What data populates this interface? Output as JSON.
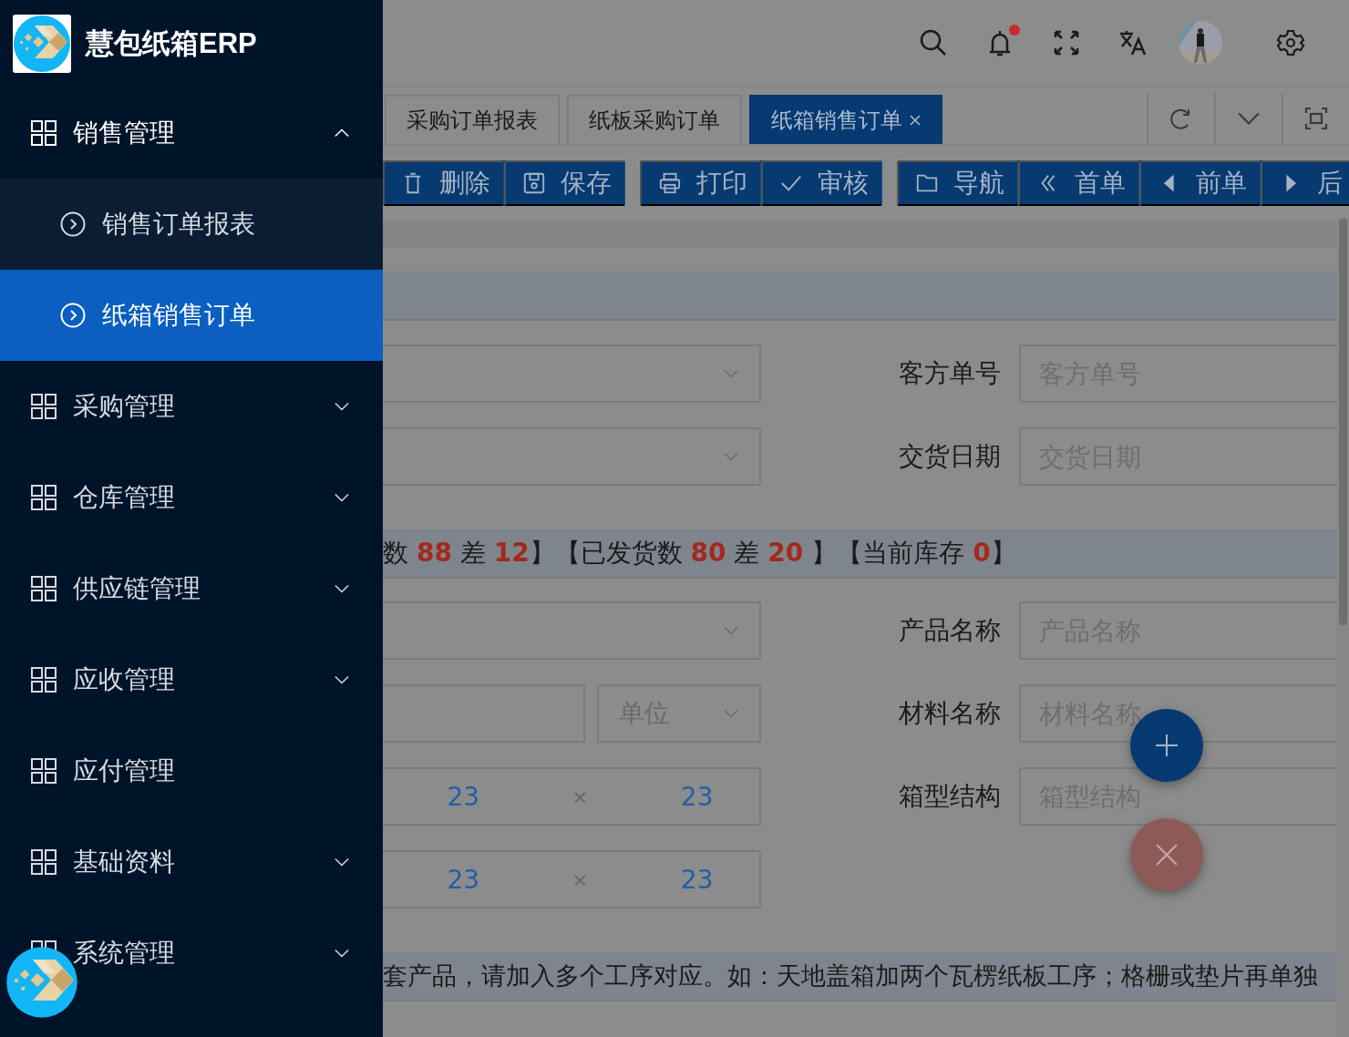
{
  "app": {
    "title": "慧包纸箱ERP"
  },
  "sidebar": {
    "items": [
      {
        "label": "销售管理",
        "kind": "submenu",
        "expanded": true,
        "children": [
          {
            "label": "销售订单报表",
            "selected": false
          },
          {
            "label": "纸箱销售订单",
            "selected": true
          }
        ]
      },
      {
        "label": "采购管理",
        "kind": "submenu",
        "expanded": false
      },
      {
        "label": "仓库管理",
        "kind": "submenu",
        "expanded": false
      },
      {
        "label": "供应链管理",
        "kind": "submenu",
        "expanded": false
      },
      {
        "label": "应收管理",
        "kind": "submenu",
        "expanded": false
      },
      {
        "label": "应付管理",
        "kind": "item"
      },
      {
        "label": "基础资料",
        "kind": "submenu",
        "expanded": false
      },
      {
        "label": "系统管理",
        "kind": "submenu",
        "expanded": false
      }
    ]
  },
  "header": {
    "has_unread": true
  },
  "tabs": [
    {
      "label": "采购订单报表",
      "selected": false
    },
    {
      "label": "纸板采购订单",
      "selected": false
    },
    {
      "label": "纸箱销售订单",
      "selected": true
    }
  ],
  "toolbar": {
    "groups": [
      [
        {
          "label": "删除",
          "kind": "delete"
        },
        {
          "label": "保存",
          "kind": "save"
        }
      ],
      [
        {
          "label": "打印",
          "kind": "print"
        },
        {
          "label": "审核",
          "kind": "approve"
        }
      ],
      [
        {
          "label": "导航",
          "kind": "navigate"
        },
        {
          "label": "首单",
          "kind": "first"
        },
        {
          "label": "前单",
          "kind": "previous"
        },
        {
          "label": "后",
          "kind": "next"
        }
      ]
    ]
  },
  "form_top": [
    {
      "left": {
        "kind": "select"
      },
      "right": {
        "label": "客方单号",
        "placeholder": "客方单号"
      }
    },
    {
      "left": {
        "kind": "select"
      },
      "right": {
        "label": "交货日期",
        "placeholder": "交货日期"
      }
    }
  ],
  "stock_info": {
    "text": "数 **88** 差 **12**】【已发货数 **80** 差 **20** 】【当前库存 **0**】"
  },
  "form_bottom": [
    {
      "left": {
        "kind": "select"
      },
      "right": {
        "label": "产品名称",
        "placeholder": "产品名称"
      }
    },
    {
      "left": {
        "kind": "input_unit",
        "unit_placeholder": "单位"
      },
      "right": {
        "label": "材料名称",
        "placeholder": "材料名称"
      }
    },
    {
      "left": {
        "kind": "size",
        "values": [
          "23",
          "23"
        ],
        "separator": "×"
      },
      "right": {
        "label": "箱型结构",
        "placeholder": "箱型结构"
      }
    },
    {
      "left": {
        "kind": "size",
        "values": [
          "23",
          "23"
        ],
        "separator": "×"
      }
    }
  ],
  "note": {
    "text": "套产品，请加入多个工序对应。如：天地盖箱加两个瓦楞纸板工序；格栅或垫片再单独"
  }
}
